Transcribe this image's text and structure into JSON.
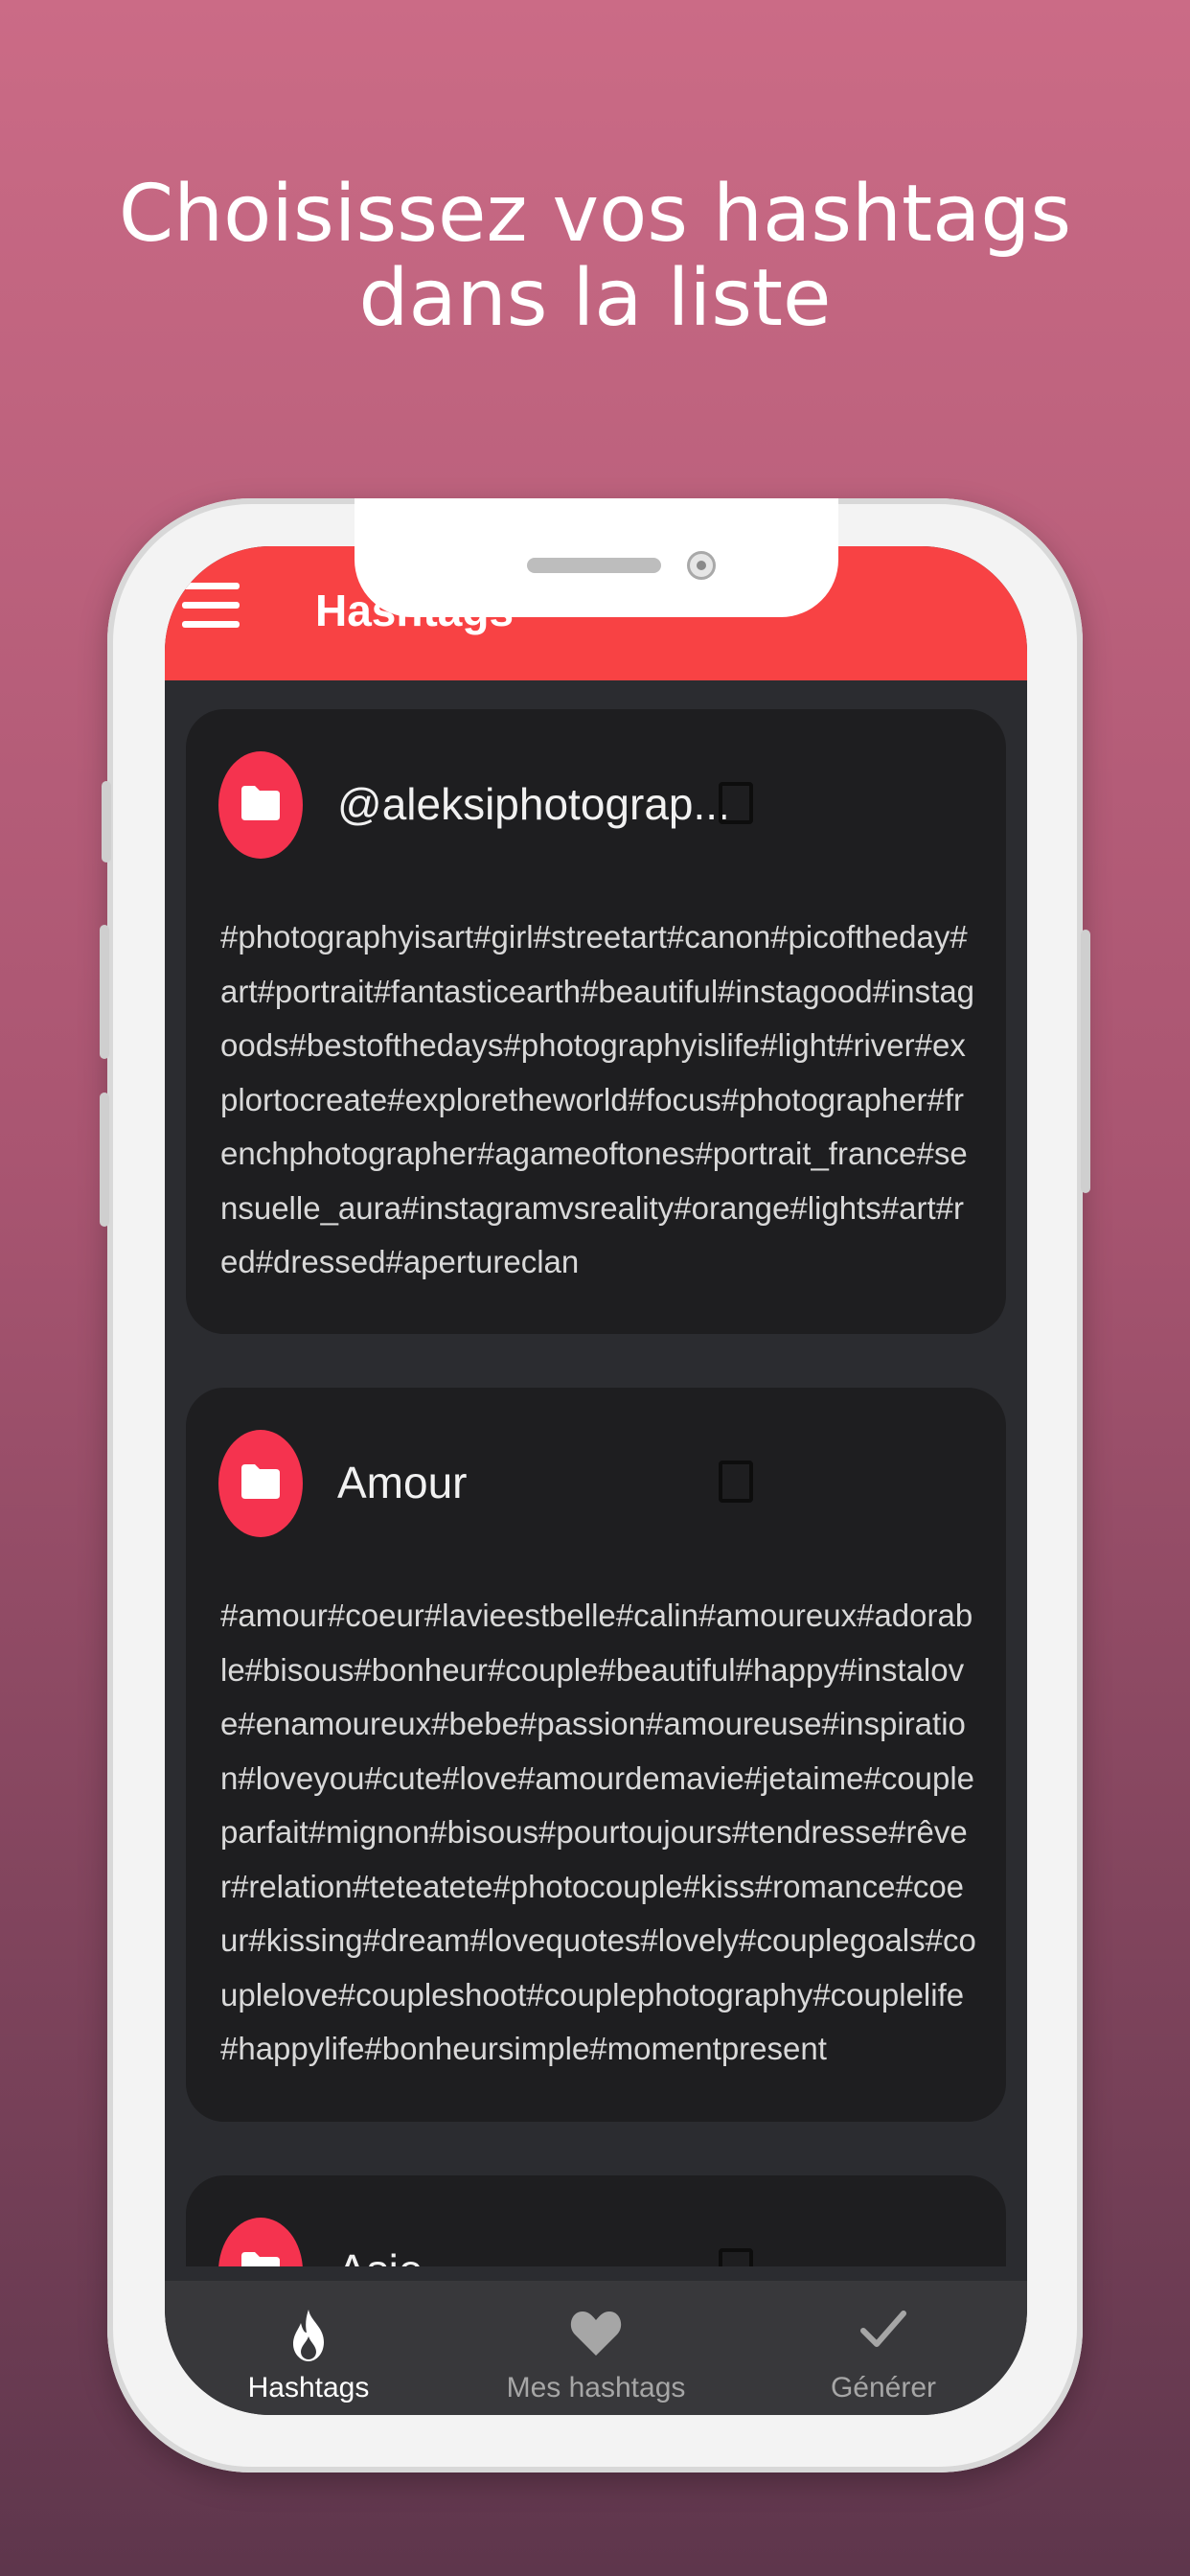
{
  "headline": {
    "line1": "Choisissez vos hashtags",
    "line2": "dans la liste"
  },
  "appbar": {
    "title": "Hashtags"
  },
  "cards": [
    {
      "title": "@aleksiphotograp...",
      "tags": "#photographyisart#girl#streetart#canon#picoftheday#art#portrait#fantasticearth#beautiful#instagood#instagoods#bestofthedays#photographyislife#light#river#explortocreate#exploretheworld#focus#photographer#frenchphotographer#agameoftones#portrait_france#sensuelle_aura#instagramvsreality#orange#lights#art#red#dressed#apertureclan"
    },
    {
      "title": "Amour",
      "tags": "#amour#coeur#lavieestbelle#calin#amoureux#adorable#bisous#bonheur#couple#beautiful#happy#instalove#enamoureux#bebe#passion#amoureuse#inspiration#loveyou#cute#love#amourdemavie#jetaime#coupleparfait#mignon#bisous#pourtoujours#tendresse#rêver#relation#teteatete#photocouple#kiss#romance#coeur#kissing#dream#lovequotes#lovely#couplegoals#couplelove#coupleshoot#couplephotography#couplelife#happylife#bonheursimple#momentpresent"
    },
    {
      "title": "Asie",
      "tags": ""
    }
  ],
  "nav": [
    {
      "label": "Hashtags",
      "icon": "flame-icon",
      "active": true
    },
    {
      "label": "Mes hashtags",
      "icon": "heart-icon",
      "active": false
    },
    {
      "label": "Générer",
      "icon": "check-icon",
      "active": false
    }
  ],
  "colors": {
    "accent": "#f84244",
    "badge": "#f5334f",
    "card": "#1e1e20",
    "screen_bg": "#2b2c30",
    "nav_bg": "#38383b",
    "nav_active": "#ffffff",
    "nav_inactive": "#a6a6a6"
  }
}
